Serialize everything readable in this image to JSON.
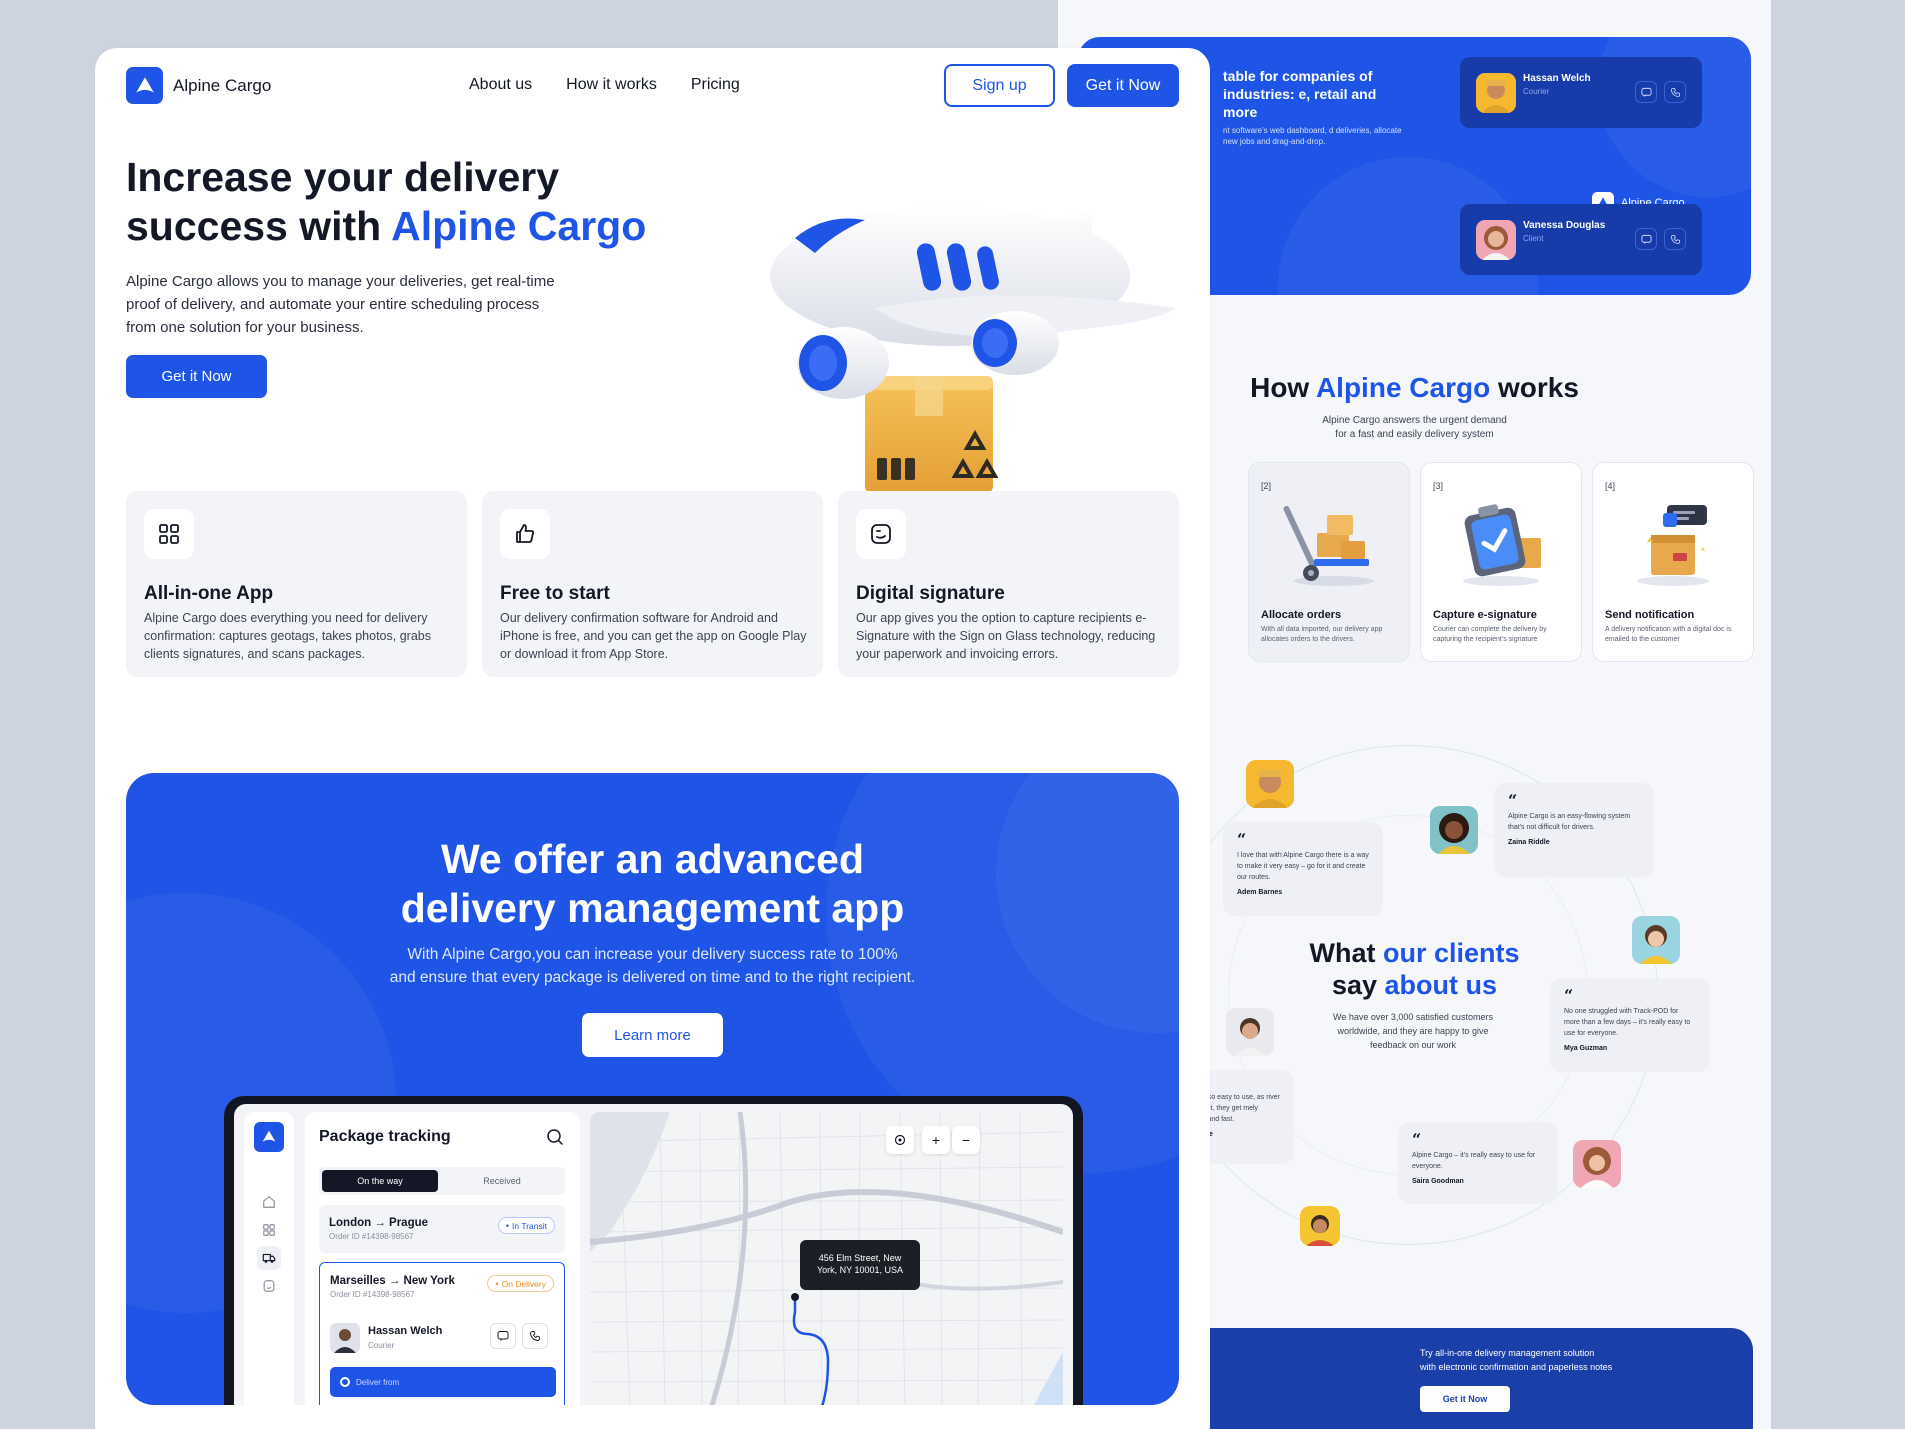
{
  "brand": {
    "name": "Alpine Cargo",
    "primary": "#1f55e6",
    "dark": "#141826"
  },
  "nav": {
    "links": [
      "About us",
      "How it works",
      "Pricing"
    ],
    "signup": "Sign up",
    "cta": "Get it Now"
  },
  "hero": {
    "title_line1": "Increase your delivery",
    "title_line2_prefix": "success with ",
    "title_highlight": "Alpine Cargo",
    "description": "Alpine Cargo allows you to manage your deliveries, get real-time proof of delivery, and automate your entire scheduling process from one solution for your business.",
    "button": "Get it Now"
  },
  "features": [
    {
      "icon": "grid-icon",
      "title": "All-in-one App",
      "desc": "Alpine Cargo does everything you need for delivery confirmation: captures geotags, takes photos, grabs clients signatures, and scans packages."
    },
    {
      "icon": "thumbs-up-icon",
      "title": "Free to start",
      "desc": "Our delivery confirmation software for Android and iPhone is free, and you can get the app on Google Play or download it from App Store."
    },
    {
      "icon": "signature-icon",
      "title": "Digital signature",
      "desc": "Our app gives you the option to capture recipients e-Signature with the Sign on Glass technology, reducing your paperwork and invoicing errors."
    }
  ],
  "advanced": {
    "title_line1": "We offer an advanced",
    "title_line2": "delivery management app",
    "desc_line1": "With Alpine Cargo,you can increase your delivery success rate to 100%",
    "desc_line2": "and ensure that every package is delivered on time and to the right recipient.",
    "button": "Learn more"
  },
  "tracking": {
    "title": "Package tracking",
    "tab_active": "On the way",
    "tab_inactive": "Received",
    "orders": [
      {
        "route": "London → Prague",
        "order_id": "Order ID #14398-98567",
        "status": "In Transit",
        "status_color": "#1f55e6"
      },
      {
        "route": "Marseilles → New York",
        "order_id": "Order ID #14398-98567",
        "status": "On Delivery",
        "status_color": "#f08a1c"
      }
    ],
    "courier": {
      "name": "Hassan Welch",
      "role": "Courier"
    },
    "deliver_from": "Deliver from",
    "map_tooltip": "456 Elm Street, New York, NY 10001, USA",
    "zoom_in": "+",
    "zoom_out": "−"
  },
  "right": {
    "hero_heading": "table for companies of industries: e, retail and more",
    "hero_sub": "nt software's web dashboard, d deliveries, allocate new jobs and drag-and-drop.",
    "contacts": [
      {
        "name": "Hassan Welch",
        "role": "Courier"
      },
      {
        "name": "Vanessa Douglas",
        "role": "Client"
      }
    ],
    "logo": "Alpine Cargo",
    "how_prefix": "How ",
    "how_highlight": "Alpine Cargo",
    "how_suffix": " works",
    "how_sub_line1": "Alpine Cargo answers the urgent demand",
    "how_sub_line2": "for a fast and easily delivery system",
    "steps": [
      {
        "num": "[2]",
        "title": "Allocate orders",
        "desc": "With all data imported, our delivery app allocates orders to the drivers."
      },
      {
        "num": "[3]",
        "title": "Capture e-signature",
        "desc": "Courier can complete the delivery by capturing the recipient's signature"
      },
      {
        "num": "[4]",
        "title": "Send notification",
        "desc": "A delivery notification with a digital doc is emailed to the customer"
      }
    ],
    "clients_title_a": "What ",
    "clients_title_b": "our clients",
    "clients_title_c": "say ",
    "clients_title_d": "about us",
    "clients_sub": "We have over 3,000 satisfied customers worldwide, and they are happy to give feedback on our work",
    "quotes": [
      {
        "text": "I love that with Alpine Cargo there is a way to make it very easy – go for it and create our routes.",
        "author": "Adem Barnes"
      },
      {
        "text": "Alpine Cargo is an easy-flowing system that's not difficult for drivers.",
        "author": "Zaina Riddle"
      },
      {
        "text": "No one struggled with Track-POD for more than a few days – it's really easy to use for everyone.",
        "author": "Mya Guzman"
      },
      {
        "text": "e Cargo is so easy to use, as river drives with it, they get mely consistent and fast.",
        "author": "evelt Chase"
      },
      {
        "text": "Alpine Cargo – it's really easy to use for everyone.",
        "author": "Saira Goodman"
      }
    ],
    "footer_text_line1": "Try all-in-one delivery management solution",
    "footer_text_line2": "with electronic confirmation and paperless notes",
    "footer_button": "Get it Now"
  }
}
